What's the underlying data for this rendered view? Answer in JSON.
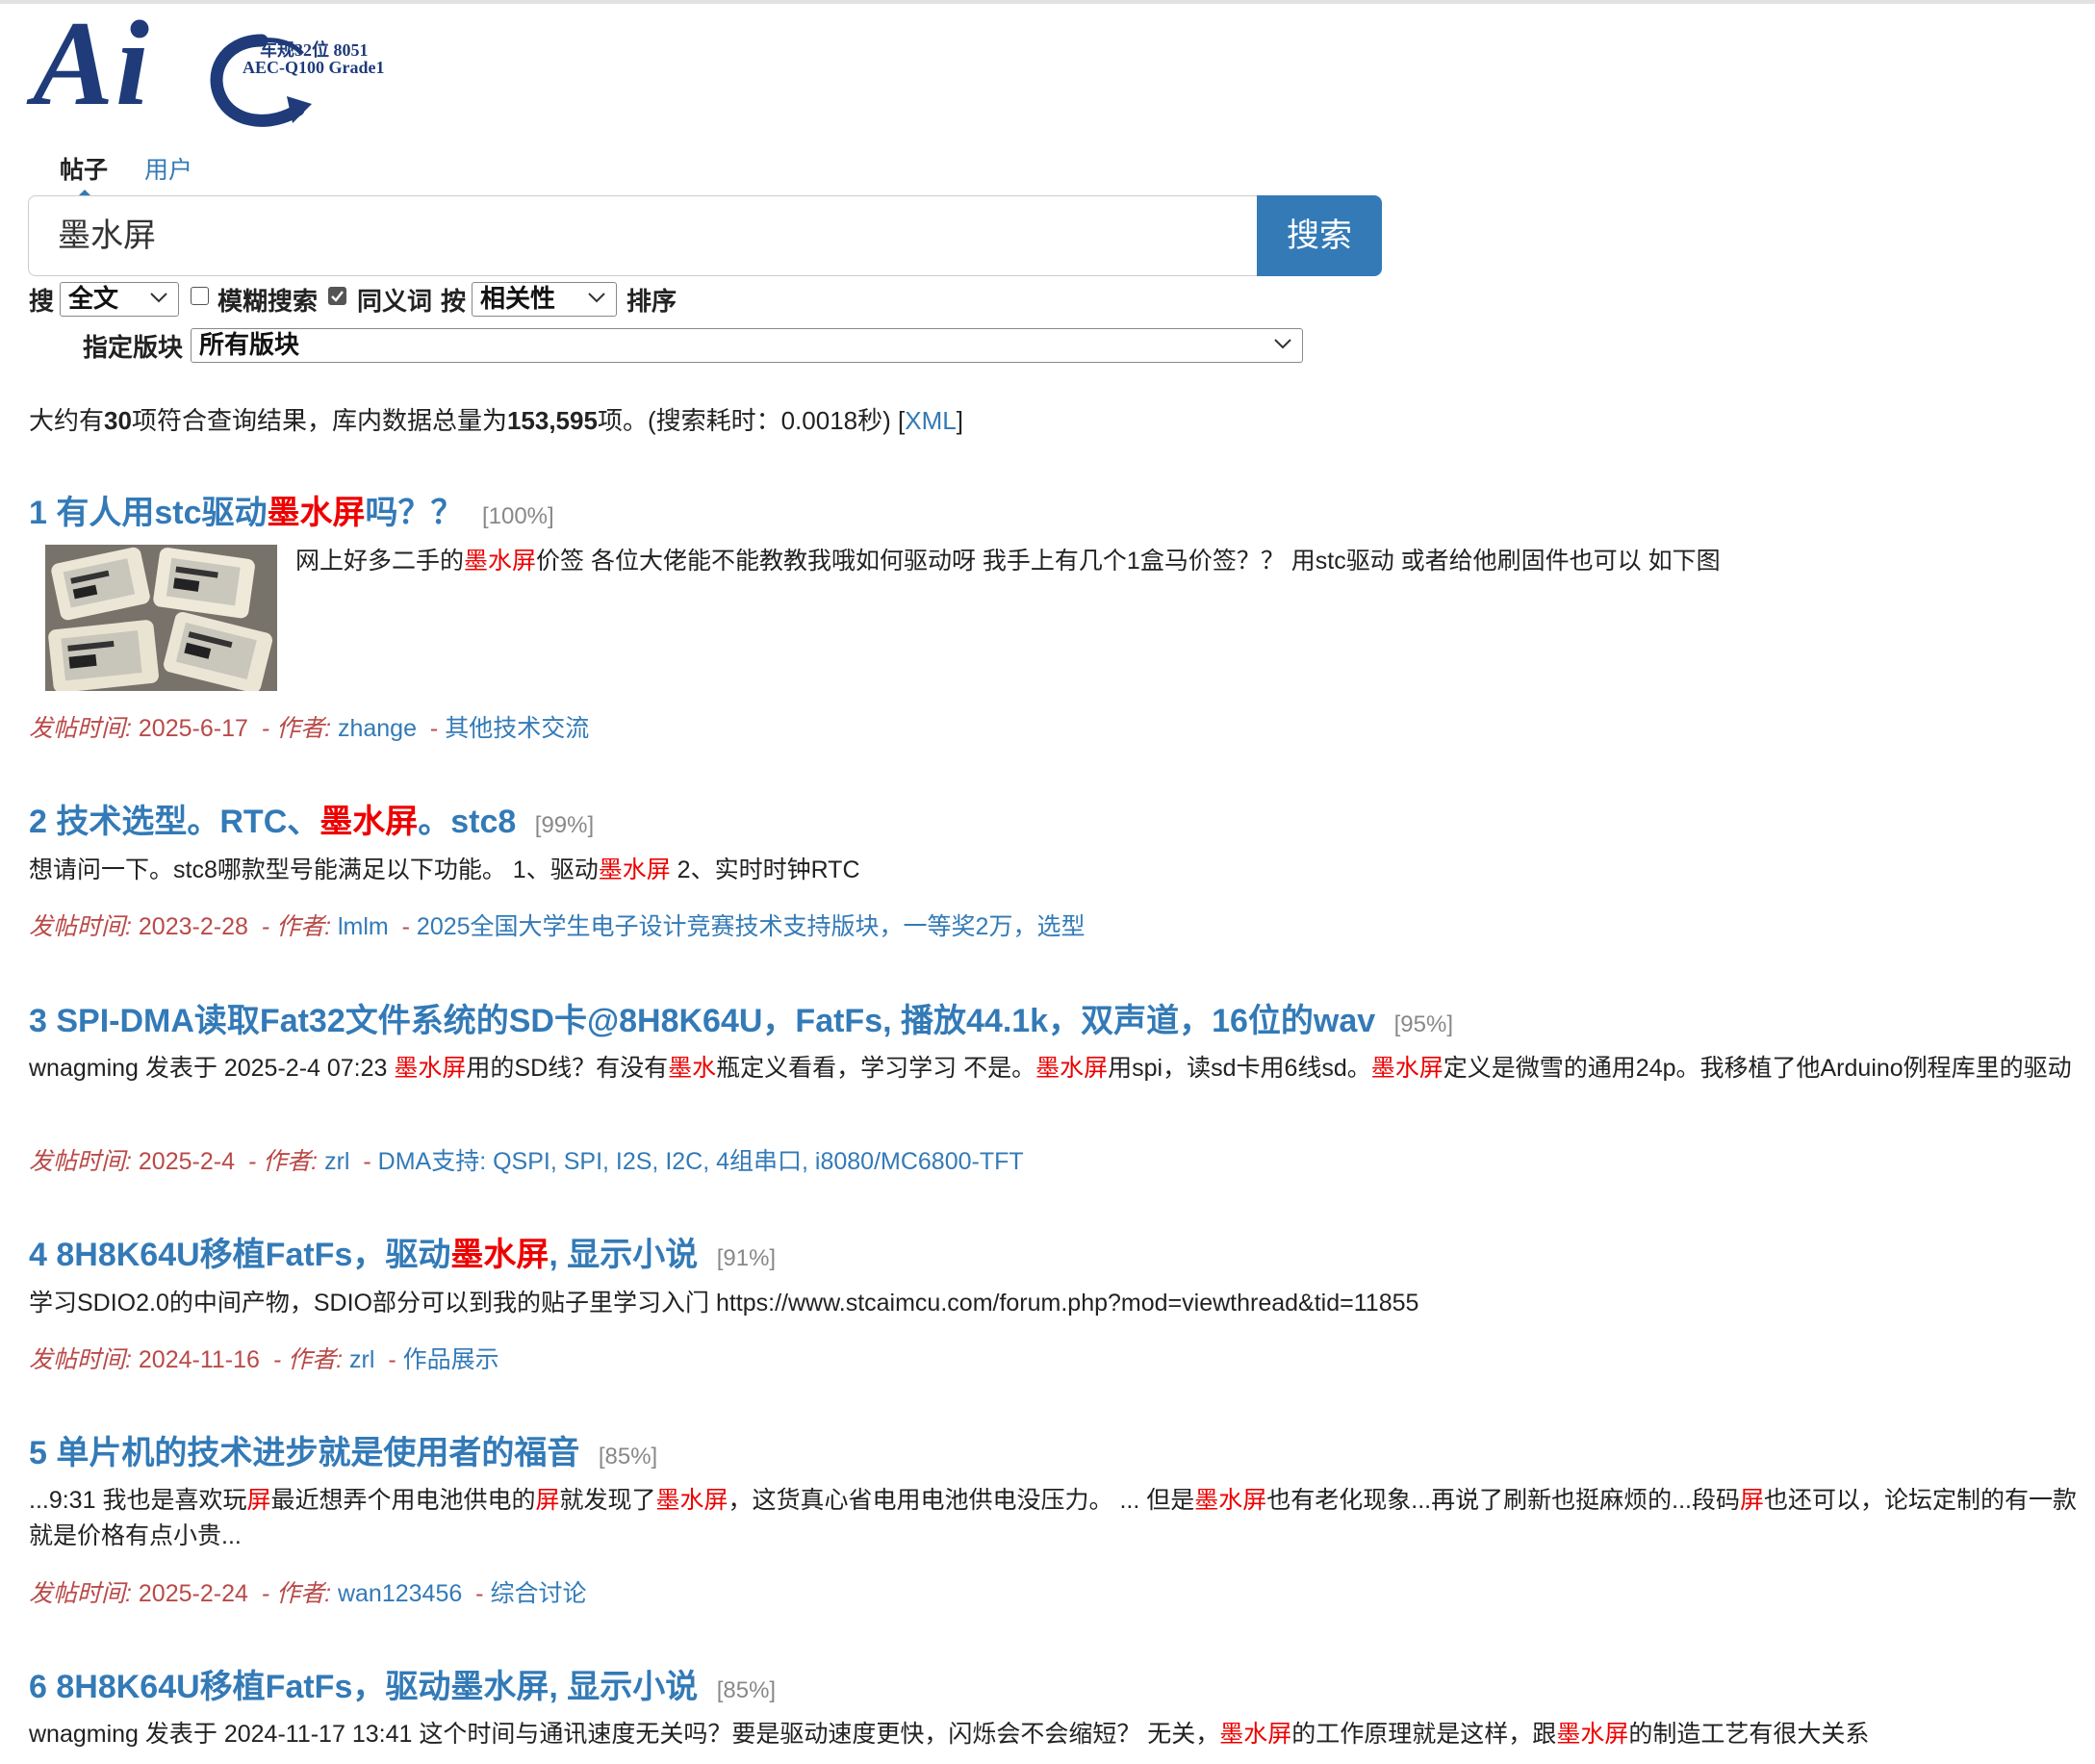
{
  "logo": {
    "big_text": "Ai",
    "line1": "车规32位 8051",
    "line2": "AEC-Q100 Grade1"
  },
  "tabs": [
    {
      "label": "帖子",
      "active": true
    },
    {
      "label": "用户",
      "active": false
    }
  ],
  "search": {
    "query": "墨水屏",
    "button_label": "搜索"
  },
  "options": {
    "search_in_label": "搜",
    "search_in_value": "全文",
    "fuzzy_label": "模糊搜索",
    "fuzzy_checked": false,
    "synonym_label": "同义词",
    "synonym_checked": true,
    "order_label": "按",
    "order_value": "相关性",
    "sort_label": "排序",
    "forum_label": "指定版块",
    "forum_value": "所有版块"
  },
  "summary": {
    "prefix": "大约有",
    "count": "30",
    "mid": "项符合查询结果，库内数据总量为",
    "total": "153,595",
    "suffix": "项。(搜索耗时：0.0018秒)  [",
    "xml_link": "XML",
    "end": "]"
  },
  "meta_labels": {
    "time": "发帖时间:",
    "author": "- 作者:",
    "sep": "-"
  },
  "results": [
    {
      "index": "1",
      "title_parts": [
        {
          "t": "有人用stc驱动",
          "hl": false
        },
        {
          "t": "墨水屏",
          "hl": true
        },
        {
          "t": "吗？？",
          "hl": false
        }
      ],
      "score": "[100%]",
      "snippet_parts": [
        {
          "t": "网上好多二手的",
          "hl": false
        },
        {
          "t": "墨水屏",
          "hl": true
        },
        {
          "t": "价签 各位大佬能不能教教我哦如何驱动呀 我手上有几个1盒马价签？？  用stc驱动 或者给他刷固件也可以 如下图",
          "hl": false
        }
      ],
      "date": "2025-6-17",
      "author": "zhange",
      "forum": "其他技术交流",
      "has_thumb": true
    },
    {
      "index": "2",
      "title_parts": [
        {
          "t": "技术选型。RTC、",
          "hl": false
        },
        {
          "t": "墨水屏",
          "hl": true
        },
        {
          "t": "。stc8",
          "hl": false
        }
      ],
      "score": "[99%]",
      "snippet_parts": [
        {
          "t": "想请问一下。stc8哪款型号能满足以下功能。 1、驱动",
          "hl": false
        },
        {
          "t": "墨水屏",
          "hl": true
        },
        {
          "t": " 2、实时时钟RTC",
          "hl": false
        }
      ],
      "date": "2023-2-28",
      "author": "lmlm",
      "forum": "2025全国大学生电子设计竞赛技术支持版块，一等奖2万，选型"
    },
    {
      "index": "3",
      "title_parts": [
        {
          "t": "SPI-DMA读取Fat32文件系统的SD卡@8H8K64U，FatFs, 播放44.1k，双声道，16位的wav",
          "hl": false
        }
      ],
      "score": "[95%]",
      "snippet_parts": [
        {
          "t": "wnagming 发表于 2025-2-4 07:23 ",
          "hl": false
        },
        {
          "t": "墨水屏",
          "hl": true
        },
        {
          "t": "用的SD线？有没有",
          "hl": false
        },
        {
          "t": "墨水",
          "hl": true
        },
        {
          "t": "瓶定义看看，学习学习 不是。",
          "hl": false
        },
        {
          "t": "墨水屏",
          "hl": true
        },
        {
          "t": "用spi，读sd卡用6线sd。",
          "hl": false
        },
        {
          "t": "墨水屏",
          "hl": true
        },
        {
          "t": "定义是微雪的通用24p。我移植了他Arduino例程库里的驱动",
          "hl": false
        }
      ],
      "date": "2025-2-4",
      "author": "zrl",
      "forum": "DMA支持: QSPI, SPI, I2S, I2C, 4组串口, i8080/MC6800-TFT"
    },
    {
      "index": "4",
      "title_parts": [
        {
          "t": "8H8K64U移植FatFs，驱动",
          "hl": false
        },
        {
          "t": "墨水屏",
          "hl": true
        },
        {
          "t": ", 显示小说",
          "hl": false
        }
      ],
      "score": "[91%]",
      "snippet_parts": [
        {
          "t": "学习SDIO2.0的中间产物，SDIO部分可以到我的贴子里学习入门 https://www.stcaimcu.com/forum.php?mod=viewthread&tid=11855",
          "hl": false
        }
      ],
      "date": "2024-11-16",
      "author": "zrl",
      "forum": "作品展示"
    },
    {
      "index": "5",
      "title_parts": [
        {
          "t": "单片机的技术进步就是使用者的福音",
          "hl": false
        }
      ],
      "score": "[85%]",
      "snippet_parts": [
        {
          "t": "...9:31 我也是喜欢玩",
          "hl": false
        },
        {
          "t": "屏",
          "hl": true
        },
        {
          "t": "最近想弄个用电池供电的",
          "hl": false
        },
        {
          "t": "屏",
          "hl": true
        },
        {
          "t": "就发现了",
          "hl": false
        },
        {
          "t": "墨水屏",
          "hl": true
        },
        {
          "t": "，这货真心省电用电池供电没压力。 ... 但是",
          "hl": false
        },
        {
          "t": "墨水屏",
          "hl": true
        },
        {
          "t": "也有老化现象...再说了刷新也挺麻烦的...段码",
          "hl": false
        },
        {
          "t": "屏",
          "hl": true
        },
        {
          "t": "也还可以，论坛定制的有一款就是价格有点小贵...",
          "hl": false
        }
      ],
      "date": "2025-2-24",
      "author": "wan123456",
      "forum": "综合讨论"
    },
    {
      "index": "6",
      "title_parts": [
        {
          "t": "8H8K64U移植FatFs，驱动墨水屏, 显示小说",
          "hl": false
        }
      ],
      "score": "[85%]",
      "snippet_parts": [
        {
          "t": "wnagming 发表于 2024-11-17 13:41 这个时间与通讯速度无关吗？要是驱动速度更快，闪烁会不会缩短？ 无关，",
          "hl": false
        },
        {
          "t": "墨水屏",
          "hl": true
        },
        {
          "t": "的工作原理就是这样，跟",
          "hl": false
        },
        {
          "t": "墨水屏",
          "hl": true
        },
        {
          "t": "的制造工艺有很大关系",
          "hl": false
        }
      ]
    }
  ],
  "colors": {
    "link": "#337ab7",
    "highlight": "#ee0000",
    "meta": "#b94a48",
    "button": "#337ab7"
  }
}
